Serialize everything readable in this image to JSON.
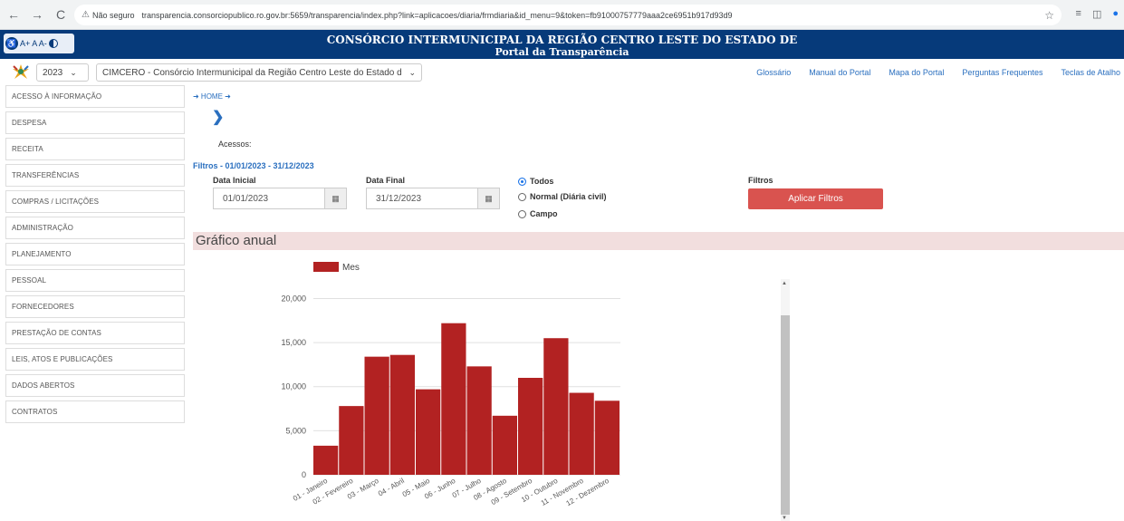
{
  "browser": {
    "back": "←",
    "forward": "→",
    "reload": "C",
    "warning_icon": "⚠",
    "not_secure": "Não seguro",
    "url": "transparencia.consorciopublico.ro.gov.br:5659/transparencia/index.php?link=aplicacoes/diaria/frmdiaria&id_menu=9&token=fb91000757779aaa2ce6951b917d93d9",
    "star": "☆"
  },
  "header": {
    "access_label": "A+ A A-",
    "title_line1": "CONSÓRCIO INTERMUNICIPAL DA REGIÃO CENTRO LESTE DO ESTADO DE",
    "title_line2": "Portal da Transparência"
  },
  "subbar": {
    "year": "2023",
    "entity": "CIMCERO - Consórcio Intermunicipal da Região Centro Leste do Estado de RO",
    "links": [
      "Glossário",
      "Manual do Portal",
      "Mapa do Portal",
      "Perguntas Frequentes",
      "Teclas de Atalho"
    ]
  },
  "sidebar": {
    "items": [
      "ACESSO À INFORMAÇÃO",
      "DESPESA",
      "RECEITA",
      "TRANSFERÊNCIAS",
      "COMPRAS / LICITAÇÕES",
      "ADMINISTRAÇÃO",
      "PLANEJAMENTO",
      "PESSOAL",
      "FORNECEDORES",
      "PRESTAÇÃO DE CONTAS",
      "LEIS, ATOS E PUBLICAÇÕES",
      "DADOS ABERTOS",
      "CONTRATOS"
    ]
  },
  "main": {
    "breadcrumb": "➜ HOME ➜",
    "chevron": "❯",
    "acessos": "Acessos:",
    "filter_range": "Filtros - 01/01/2023 - 31/12/2023",
    "data_inicial_label": "Data Inicial",
    "data_inicial": "01/01/2023",
    "data_final_label": "Data Final",
    "data_final": "31/12/2023",
    "calendar_icon": "▦",
    "radios": [
      "Todos",
      "Normal (Diária civil)",
      "Campo"
    ],
    "selected_radio": "Todos",
    "filtros_label": "Filtros",
    "apply_button": "Aplicar Filtros",
    "section_title": "Gráfico anual"
  },
  "colors": {
    "header_bg": "#063a7a",
    "bar": "#b22222",
    "button": "#d9534f",
    "section_bg": "#f2dede",
    "link": "#2a6fbf"
  },
  "chart_data": {
    "type": "bar",
    "categories": [
      "01 - Janeiro",
      "02 - Fevereiro",
      "03 - Março",
      "04 - Abril",
      "05 - Maio",
      "06 - Junho",
      "07 - Julho",
      "08 - Agosto",
      "09 - Setembro",
      "10 - Outubro",
      "11 - Novembro",
      "12 - Dezembro"
    ],
    "series": [
      {
        "name": "Mes",
        "values": [
          3300,
          7800,
          13400,
          13600,
          9700,
          17200,
          12300,
          6700,
          11000,
          15500,
          9300,
          8400
        ]
      }
    ],
    "ylim": [
      0,
      22000
    ],
    "yticks": [
      0,
      5000,
      10000,
      15000,
      20000
    ],
    "ytick_labels": [
      "0",
      "5,000",
      "10,000",
      "15,000",
      "20,000"
    ],
    "legend": "top-left",
    "grid": true
  }
}
